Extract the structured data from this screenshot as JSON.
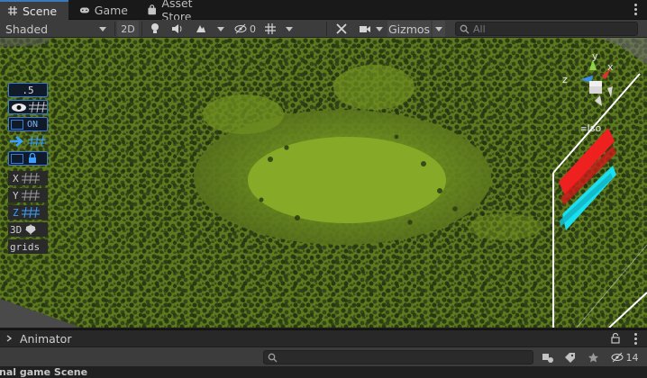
{
  "tabs": [
    {
      "label": "Scene",
      "icon": "grid-icon",
      "active": true
    },
    {
      "label": "Game",
      "icon": "gamepad-icon",
      "active": false
    },
    {
      "label": "Asset Store",
      "icon": "bag-icon",
      "active": false
    }
  ],
  "toolbar": {
    "shading_mode": "Shaded",
    "mode_2d": "2D",
    "hidden_count": "0",
    "gizmos_label": "Gizmos",
    "search_placeholder": "All"
  },
  "overlay": {
    "size_value": ".5",
    "snap_toggle": "ON",
    "axis_x": "X",
    "axis_y": "Y",
    "axis_z": "Z",
    "mode_3d": "3D",
    "grids_label": "grids"
  },
  "orientation_gizmo": {
    "axis_y": "y",
    "axis_x": "x",
    "axis_z": "z",
    "projection": "Iso"
  },
  "animator": {
    "title": "Animator",
    "layer_count": "14",
    "scene_name": "nal game Scene"
  },
  "colors": {
    "accent": "#3a79bb",
    "terrain": "#8da62b",
    "axis_x": "#e0322a",
    "axis_y": "#8fd14a",
    "axis_z": "#3d8ee6"
  }
}
